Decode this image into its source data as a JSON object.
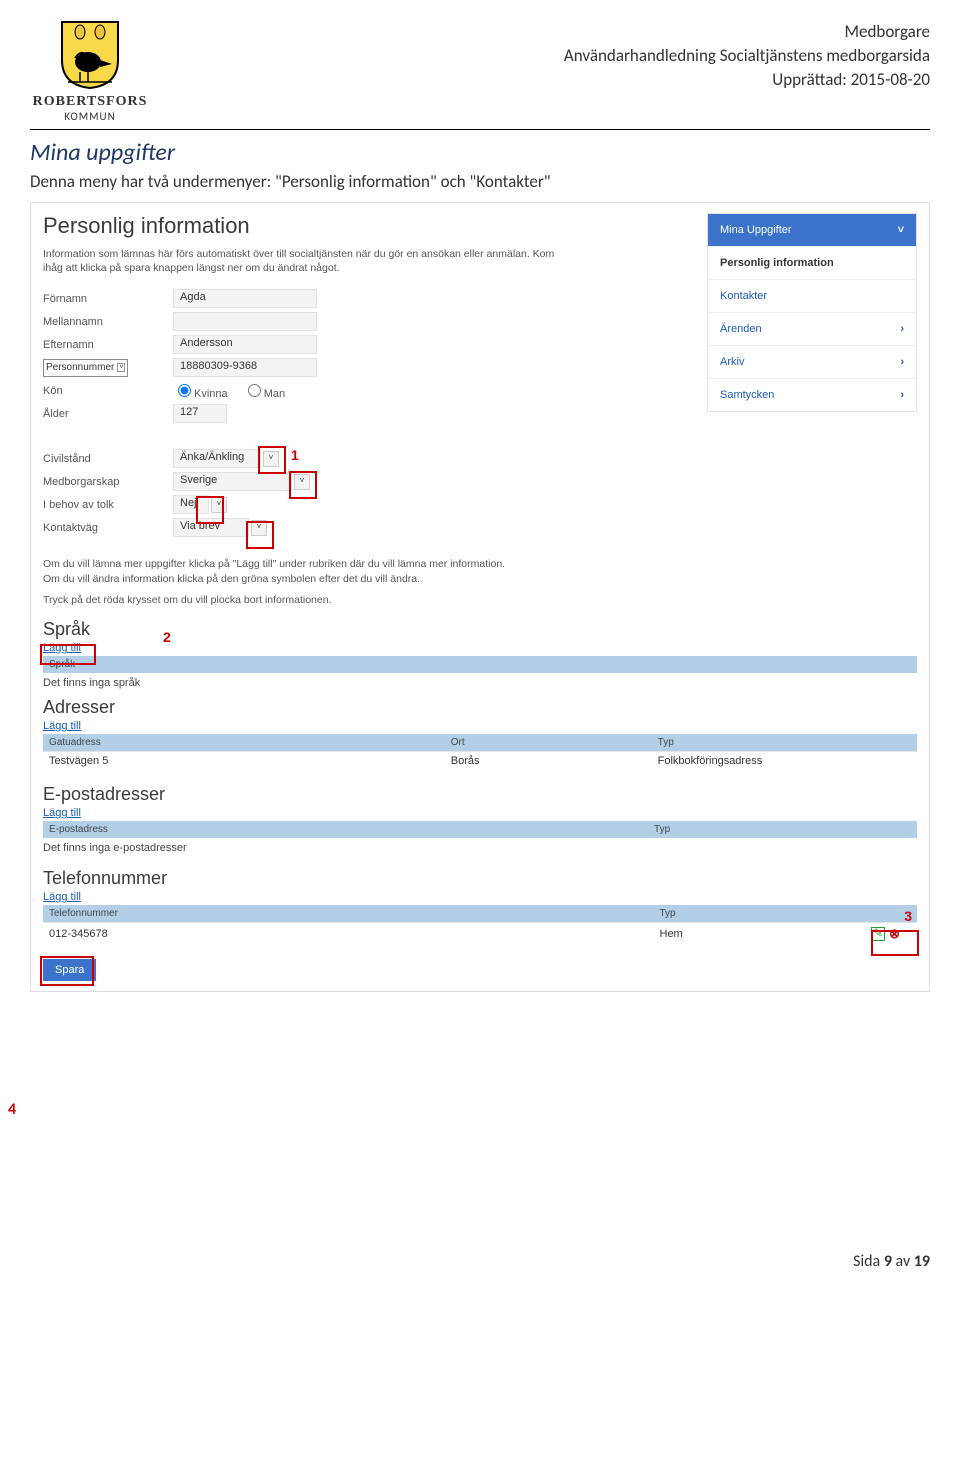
{
  "header": {
    "kommun_name": "ROBERTSFORS",
    "kommun_sub": "KOMMUN",
    "line1": "Medborgare",
    "line2": "Användarhandledning Socialtjänstens medborgarsida",
    "line3": "Upprättad: 2015-08-20"
  },
  "doc": {
    "section_title": "Mina uppgifter",
    "intro": "Denna meny har två undermenyer: \"Personlig information\" och \"Kontakter\""
  },
  "shot": {
    "title": "Personlig information",
    "desc": "Information som lämnas här förs automatiskt över till socialtjänsten när du gör en ansökan eller anmälan. Kom ihåg att klicka på spara knappen längst ner om du ändrat något.",
    "form": {
      "fornamn_lbl": "Förnamn",
      "fornamn_val": "Agda",
      "mellannamn_lbl": "Mellannamn",
      "mellannamn_val": "",
      "efternamn_lbl": "Efternamn",
      "efternamn_val": "Andersson",
      "pnr_lbl": "Personnummer",
      "pnr_val": "18880309-9368",
      "kon_lbl": "Kön",
      "kon_kvinna": "Kvinna",
      "kon_man": "Man",
      "alder_lbl": "Ålder",
      "alder_val": "127",
      "civil_lbl": "Civilstånd",
      "civil_val": "Änka/Änkling",
      "medb_lbl": "Medborgarskap",
      "medb_val": "Sverige",
      "tolk_lbl": "I behov av tolk",
      "tolk_val": "Nej",
      "kontakt_lbl": "Kontaktväg",
      "kontakt_val": "Via brev"
    },
    "info_p1": "Om du vill lämna mer uppgifter klicka på \"Lägg till\" under rubriken där du vill lämna mer information.",
    "info_p2": "Om du vill ändra information klicka på den gröna symbolen efter det du vill ändra.",
    "info_p3": "Tryck på det röda krysset om du vill plocka bort informationen.",
    "sprak": {
      "title": "Språk",
      "add": "Lägg till",
      "hdr": "Språk",
      "empty": "Det finns inga språk"
    },
    "adresser": {
      "title": "Adresser",
      "add": "Lägg till",
      "h1": "Gatuadress",
      "h2": "Ort",
      "h3": "Typ",
      "r1c1": "Testvägen 5",
      "r1c2": "Borås",
      "r1c3": "Folkbokföringsadress"
    },
    "epost": {
      "title": "E-postadresser",
      "add": "Lägg till",
      "h1": "E-postadress",
      "h2": "Typ",
      "empty": "Det finns inga e-postadresser"
    },
    "tel": {
      "title": "Telefonnummer",
      "add": "Lägg till",
      "h1": "Telefonnummer",
      "h2": "Typ",
      "r1c1": "012-345678",
      "r1c2": "Hem"
    },
    "save": "Spara",
    "side": {
      "mina": "Mina Uppgifter",
      "personlig": "Personlig information",
      "kontakter": "Kontakter",
      "arenden": "Ärenden",
      "arkiv": "Arkiv",
      "samtycken": "Samtycken"
    },
    "annot": {
      "a1": "1",
      "a2": "2",
      "a3": "3",
      "a4": "4"
    }
  },
  "footer": {
    "prefix": "Sida ",
    "page": "9",
    "mid": " av ",
    "total": "19"
  }
}
